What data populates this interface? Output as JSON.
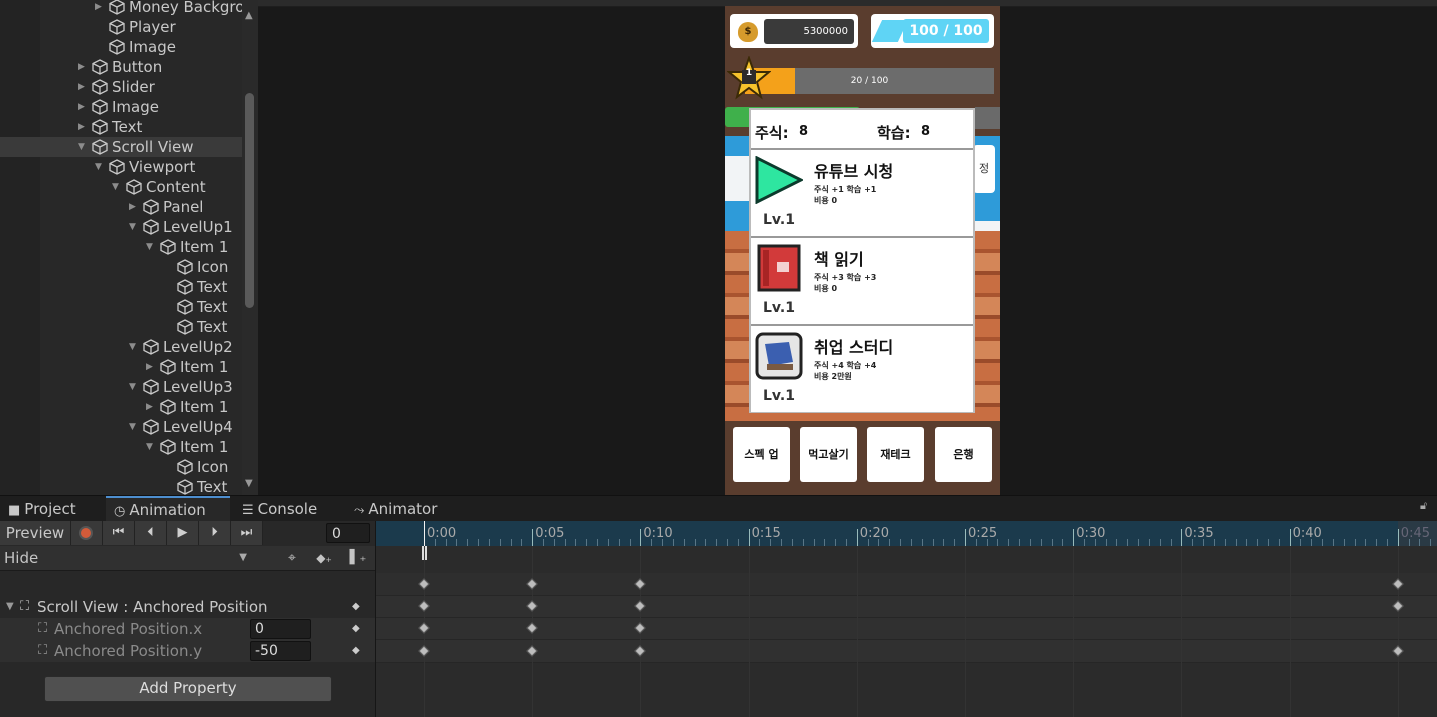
{
  "hierarchy": {
    "items": [
      {
        "label": "Money Backgro",
        "depth": 3,
        "arrow": "▶"
      },
      {
        "label": "Player",
        "depth": 3,
        "arrow": ""
      },
      {
        "label": "Image",
        "depth": 3,
        "arrow": ""
      },
      {
        "label": "Button",
        "depth": 2,
        "arrow": "▶"
      },
      {
        "label": "Slider",
        "depth": 2,
        "arrow": "▶"
      },
      {
        "label": "Image",
        "depth": 2,
        "arrow": "▶"
      },
      {
        "label": "Text",
        "depth": 2,
        "arrow": "▶"
      },
      {
        "label": "Scroll View",
        "depth": 2,
        "arrow": "▼",
        "selected": true
      },
      {
        "label": "Viewport",
        "depth": 3,
        "arrow": "▼"
      },
      {
        "label": "Content",
        "depth": 4,
        "arrow": "▼"
      },
      {
        "label": "Panel",
        "depth": 5,
        "arrow": "▶"
      },
      {
        "label": "LevelUp1",
        "depth": 5,
        "arrow": "▼"
      },
      {
        "label": "Item 1",
        "depth": 6,
        "arrow": "▼"
      },
      {
        "label": "Icon",
        "depth": 7,
        "arrow": ""
      },
      {
        "label": "Text",
        "depth": 7,
        "arrow": ""
      },
      {
        "label": "Text",
        "depth": 7,
        "arrow": ""
      },
      {
        "label": "Text",
        "depth": 7,
        "arrow": ""
      },
      {
        "label": "LevelUp2",
        "depth": 5,
        "arrow": "▼"
      },
      {
        "label": "Item 1",
        "depth": 6,
        "arrow": "▶"
      },
      {
        "label": "LevelUp3",
        "depth": 5,
        "arrow": "▼"
      },
      {
        "label": "Item 1",
        "depth": 6,
        "arrow": "▶"
      },
      {
        "label": "LevelUp4",
        "depth": 5,
        "arrow": "▼"
      },
      {
        "label": "Item 1",
        "depth": 6,
        "arrow": "▼"
      },
      {
        "label": "Icon",
        "depth": 7,
        "arrow": ""
      },
      {
        "label": "Text",
        "depth": 7,
        "arrow": ""
      }
    ]
  },
  "game": {
    "money": "5300000",
    "money_icon": "$",
    "energy": "100 / 100",
    "level": "1",
    "xp": "20 / 100",
    "xp_fraction": 0.2,
    "side_button": "정",
    "stats": {
      "stock_label": "주식:",
      "stock_value": "8",
      "study_label": "학습:",
      "study_value": "8"
    },
    "items": [
      {
        "title": "유튜브 시청",
        "line1": "주식 +1 학습 +1",
        "line2": "비용 0",
        "level": "Lv.1",
        "icon": "play-icon"
      },
      {
        "title": "책 읽기",
        "line1": "주식 +3 학습 +3",
        "line2": "비용 0",
        "level": "Lv.1",
        "icon": "book-icon"
      },
      {
        "title": "취업 스터디",
        "line1": "주식 +4 학습 +4",
        "line2": "비용 2만원",
        "level": "Lv.1",
        "icon": "study-icon"
      }
    ],
    "bottom_buttons": [
      "스펙 업",
      "먹고살기",
      "재테크",
      "은행"
    ]
  },
  "tabs": [
    {
      "label": "Project",
      "icon": "folder-icon",
      "glyph": "■"
    },
    {
      "label": "Animation",
      "icon": "clock-icon",
      "glyph": "◷",
      "active": true
    },
    {
      "label": "Console",
      "icon": "console-icon",
      "glyph": "☰"
    },
    {
      "label": "Animator",
      "icon": "animator-icon",
      "glyph": "⤳"
    }
  ],
  "animation": {
    "preview_label": "Preview",
    "frame": "0",
    "clip": "Hide",
    "property_group": "Scroll View : Anchored Position",
    "properties": [
      {
        "label": "Anchored Position.x",
        "value": "0"
      },
      {
        "label": "Anchored Position.y",
        "value": "-50"
      }
    ],
    "add_property": "Add Property",
    "timeline_labels": [
      "0:00",
      "0:05",
      "0:10",
      "0:15",
      "0:20",
      "0:25",
      "0:30",
      "0:35",
      "0:40",
      "0:45"
    ]
  },
  "colors": {
    "accent": "#4d8ecf",
    "record": "#d35b3a",
    "timeline": "#1b3a4c",
    "xp": "#f4a11a",
    "energy": "#5fd4f5",
    "play": "#2ee6a0"
  }
}
